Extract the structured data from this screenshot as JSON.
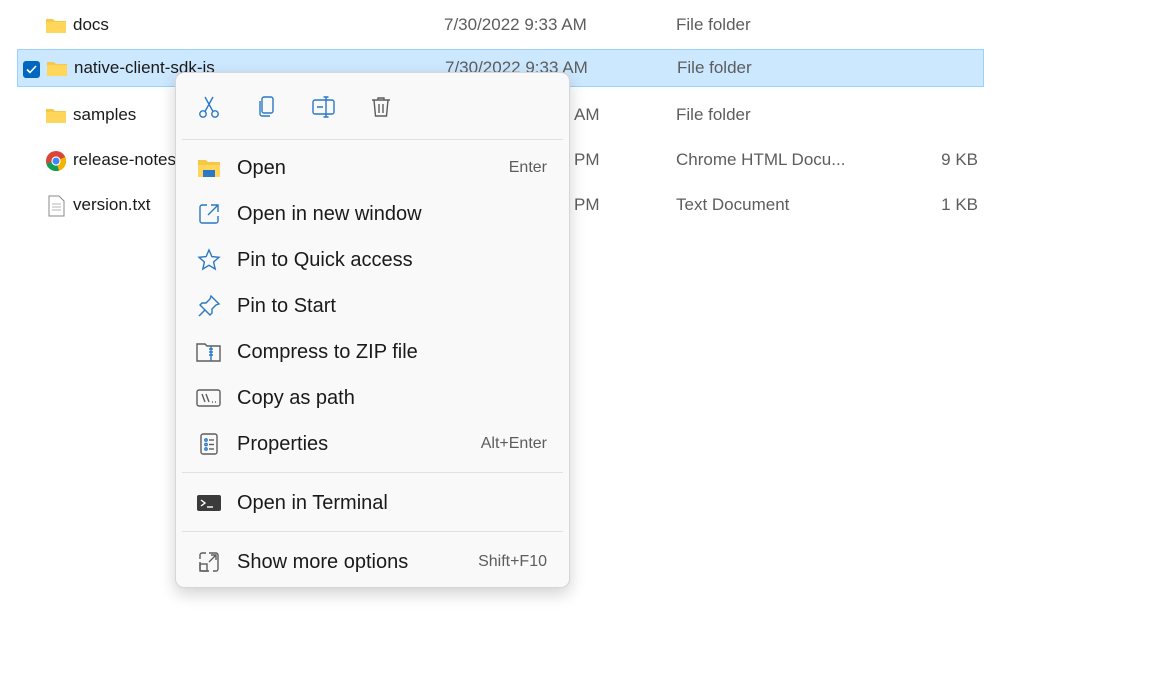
{
  "files": [
    {
      "name": "docs",
      "date": "7/30/2022 9:33 AM",
      "type": "File folder",
      "size": "",
      "icon": "folder-icon",
      "selected": false
    },
    {
      "name": "native-client-sdk-js",
      "date": "7/30/2022 9:33 AM",
      "type": "File folder",
      "size": "",
      "icon": "folder-icon",
      "selected": true
    },
    {
      "name": "samples",
      "date": "AM",
      "type": "File folder",
      "size": "",
      "icon": "folder-icon",
      "selected": false
    },
    {
      "name": "release-notes",
      "date": "PM",
      "type": "Chrome HTML Docu...",
      "size": "9 KB",
      "icon": "chrome-icon",
      "selected": false
    },
    {
      "name": "version.txt",
      "date": "PM",
      "type": "Text Document",
      "size": "1 KB",
      "icon": "text-file-icon",
      "selected": false
    }
  ],
  "context_menu": {
    "quick_actions": [
      {
        "name": "cut",
        "icon": "scissors-icon"
      },
      {
        "name": "copy",
        "icon": "copy-icon"
      },
      {
        "name": "rename",
        "icon": "rename-icon"
      },
      {
        "name": "delete",
        "icon": "trash-icon"
      }
    ],
    "items": [
      {
        "label": "Open",
        "shortcut": "Enter",
        "icon": "folder-open-icon"
      },
      {
        "label": "Open in new window",
        "shortcut": "",
        "icon": "new-window-icon"
      },
      {
        "label": "Pin to Quick access",
        "shortcut": "",
        "icon": "star-icon"
      },
      {
        "label": "Pin to Start",
        "shortcut": "",
        "icon": "pin-icon"
      },
      {
        "label": "Compress to ZIP file",
        "shortcut": "",
        "icon": "zip-icon"
      },
      {
        "label": "Copy as path",
        "shortcut": "",
        "icon": "copy-path-icon"
      },
      {
        "label": "Properties",
        "shortcut": "Alt+Enter",
        "icon": "properties-icon"
      },
      {
        "label": "Open in Terminal",
        "shortcut": "",
        "icon": "terminal-icon"
      },
      {
        "label": "Show more options",
        "shortcut": "Shift+F10",
        "icon": "more-options-icon"
      }
    ]
  },
  "colors": {
    "accent": "#0067c0",
    "selection": "#cce8ff",
    "folder": "#f5c945",
    "icon_blue": "#2b78c5"
  }
}
